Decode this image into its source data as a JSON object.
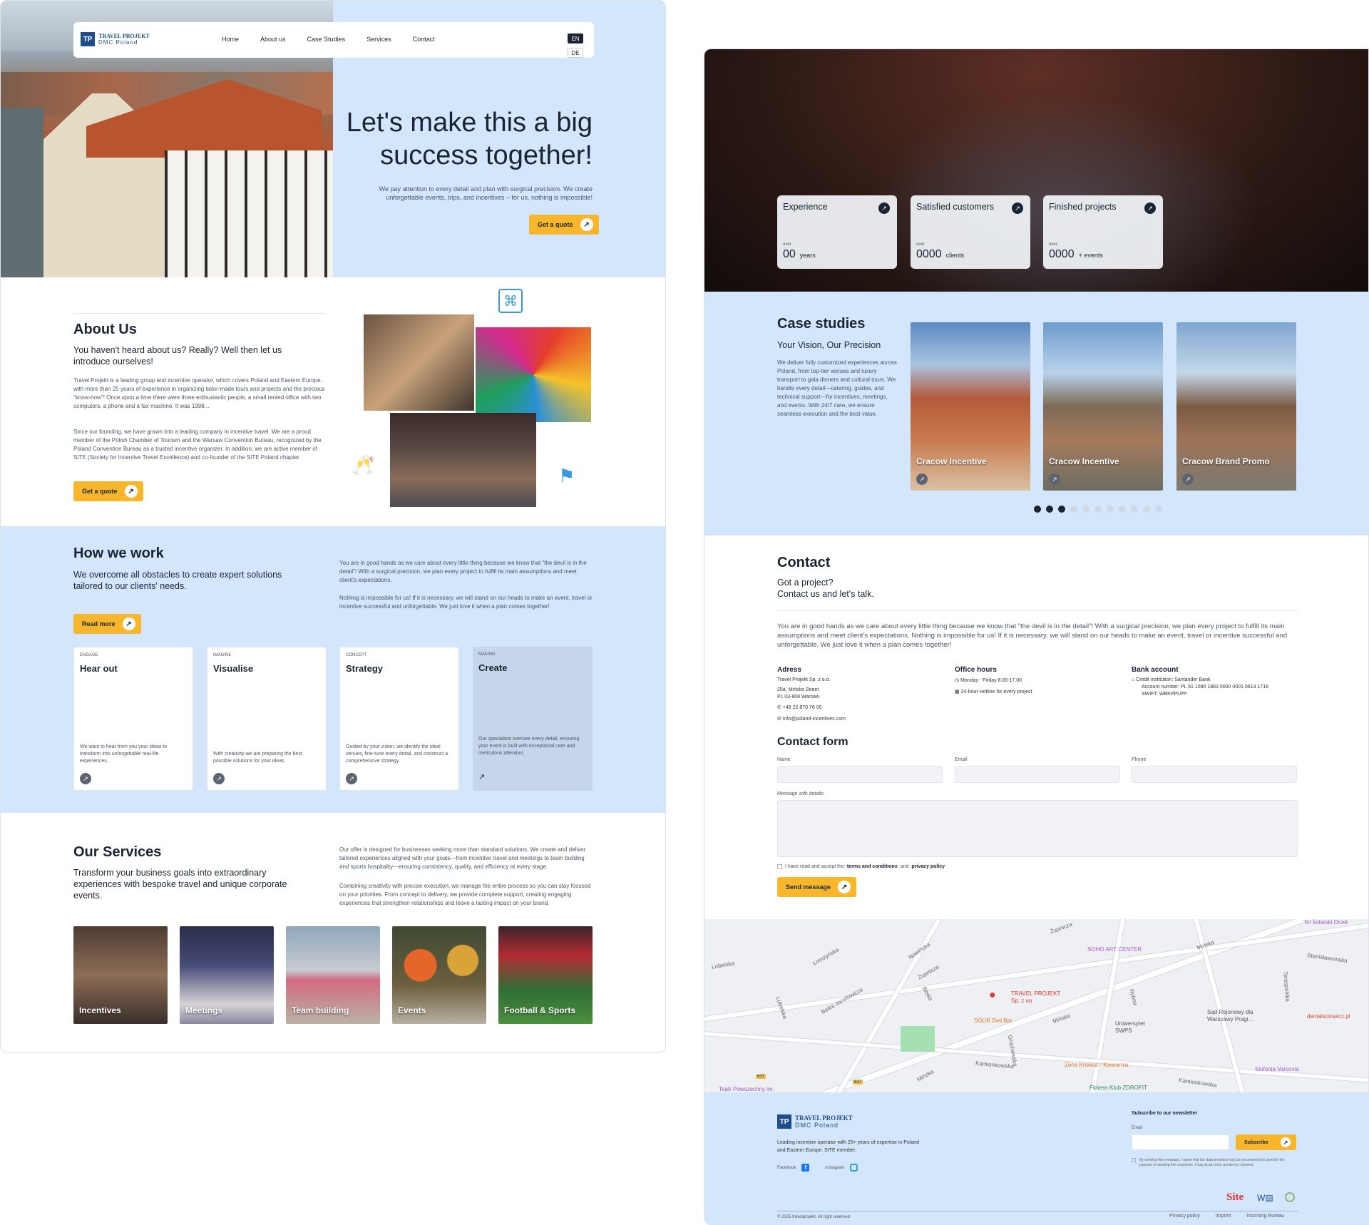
{
  "left": {
    "header": {
      "logo_line1": "TRAVEL PROJEKT",
      "logo_line2": "DMC  Poland",
      "nav": [
        "Home",
        "About us",
        "Case Studies",
        "Services",
        "Contact"
      ],
      "lang_active": "EN",
      "lang_other": "DE"
    },
    "hero": {
      "title_line1": "Let's make this a big",
      "title_line2": "success together!",
      "text": "We pay attention to every detail and plan with surgical precision. We create unforgettable events, trips, and incentives – for us, nothing is impossible!",
      "cta": "Get a quote"
    },
    "about": {
      "title": "About Us",
      "subtitle": "You haven't heard about us? Really? Well then let us introduce ourselves!",
      "p1": "Travel Projekt is a leading group and incentive operator, which covers Poland and Eastern Europe, with more than 25 years of experience in organizing tailor-made tours and projects and the precious \"know-how\"! Once upon a time there were three enthusiastic people, a small rented office with two computers, a phone and a fax machine. It was 1998...",
      "p2": "Since our founding, we have grown into a leading company in incentive travel. We are a proud member of the Polish Chamber of Tourism and the Warsaw Convention Bureau, recognized by the Poland Convention Bureau as a trusted incentive organizer. In addition, we are active member of SITE (Society for Incentive Travel Excellence) and co-founder of the SITE Poland chapter.",
      "cta": "Get a quote"
    },
    "how": {
      "title": "How we work",
      "subtitle": "We overcome all obstacles to create expert solutions tailored to our clients' needs.",
      "p1": "You are in good hands as we care about every little thing because we know that \"the devil is in the detail\"! With a surgical precision, we plan every project to fulfill its main assumptions and meet client's expectations.",
      "p2": "Nothing is impossible for us! If it is necessary, we will stand on our heads to make an event, travel or incentive successful and unforgettable. We just love it when a plan comes together!",
      "cta": "Read more",
      "steps": [
        {
          "tag": "ENGAGE",
          "title": "Hear out",
          "text": "We want to hear from you your ideas to transform into unforgettable real-life experiences."
        },
        {
          "tag": "IMAGINE",
          "title": "Visualise",
          "text": "With creativity we are preparing the best possible solutions for your ideas"
        },
        {
          "tag": "CONCEPT",
          "title": "Strategy",
          "text": "Guided by your vision, we identify the ideal venues, fine-tune every detail, and construct a comprehensive strategy."
        },
        {
          "tag": "MAKING",
          "title": "Create",
          "text": "Our specialists oversee every detail, ensuring your event is built with exceptional care and meticulous attention."
        }
      ]
    },
    "services": {
      "title": "Our Services",
      "subtitle": "Transform your business goals into extraordinary experiences with bespoke travel and unique corporate events.",
      "p1": "Our offer is designed for businesses seeking more than standard solutions. We create and deliver tailored experiences aligned with your goals—from incentive travel and meetings to team building and sports hospitality—ensuring consistency, quality, and efficiency at every stage.",
      "p2": "Combining creativity with precise execution, we manage the entire process so you can stay focused on your priorities. From concept to delivery, we provide complete support, creating engaging experiences that strengthen relationships and leave a lasting impact on your brand.",
      "items": [
        "Incentives",
        "Meetings",
        "Team building",
        "Events",
        "Football & Sports"
      ]
    }
  },
  "right": {
    "stats": [
      {
        "label": "Experience",
        "over": "over",
        "value": "00",
        "unit": "years"
      },
      {
        "label": "Satisfied customers",
        "over": "over",
        "value": "0000",
        "unit": "clients"
      },
      {
        "label": "Finished projects",
        "over": "over",
        "value": "0000",
        "unit": "+   events"
      }
    ],
    "cases": {
      "title": "Case studies",
      "subtitle": "Your Vision, Our Precision",
      "text": "We deliver fully customized experiences across Poland, from top-tier venues and luxury transport to gala dinners and cultural tours. We handle every detail—catering, guides, and technical support—for incentives, meetings, and events. With 24/7 care, we ensure seamless execution and the best value.",
      "items": [
        "Cracow Incentive",
        "Cracow Incentive",
        "Cracow Brand Promo"
      ],
      "dots_active": 3,
      "dots_total": 11
    },
    "contact": {
      "title": "Contact",
      "subtitle_line1": "Got a project?",
      "subtitle_line2": "Contact us and let's talk.",
      "text": "You are in good hands as we care about every little thing because we know that \"the devil is in the detail\"! With a surgical precision, we plan every project to fulfill its main assumptions and meet client's expectations. Nothing is impossible for us! If it is necessary, we will stand on our heads to make an event, travel or incentive successful and unforgettable. We just love it when a plan comes together!",
      "address_title": "Adress",
      "address_lines": [
        "Travel Projekt Sp. z o.o.",
        "25a, Mińska Street",
        "PL 03-808 Warsaw"
      ],
      "phone": "+48 22 870 76 00",
      "email": "info@poland-incentives.com",
      "hours_title": "Office hours",
      "hours_1": "Monday - Friday 8.00-17.00",
      "hours_2": "24-hour Hotline for every project",
      "bank_title": "Bank account",
      "bank_1": "Credit institution: Santander Bank",
      "bank_2": "Account number: PL 51 1090 1883 0000 0001 0613 1716",
      "bank_3": "SWIFT: WBKPPLPP",
      "form_title": "Contact form",
      "name_label": "Name",
      "email_label": "Email",
      "phone_label": "Phone",
      "message_label": "Message with details",
      "consent_pre": "I have read and accept the ",
      "consent_terms": "terms and conditions",
      "consent_and": " and ",
      "consent_privacy": "privacy policy",
      "submit": "Send message"
    },
    "map": {
      "streets": [
        "Żupnicza",
        "Mińska",
        "Stanisławowska",
        "Lubelska",
        "Łomżyńska",
        "Nowińska",
        "Żupnicza",
        "Bliska",
        "Beika Józefowicza",
        "Lubelska",
        "Mińska",
        "Grochowska",
        "Kamionkowska",
        "Terespolska",
        "Rybna",
        "Mińska",
        "Kamionkowska"
      ],
      "pois": [
        "SOHO ART CENTER",
        "TRAVEL PROJEKT Sp. z oo",
        "SOUR Deli Bar",
        "Uniwersytet SWPS",
        "Sąd Rejonowy dla Warszawy Pragi...",
        "dentalsolowicz.pl",
        "Zona Krawca - Kawiarnia",
        "Sinfonia Varsovia",
        "Fitness Klub ZDROFIT",
        "Teatr Powszechny im.",
        "Tor kolarski Orzeł"
      ],
      "routes": [
        "637",
        "637"
      ]
    },
    "footer": {
      "logo_line1": "TRAVEL PROJEKT",
      "logo_line2": "DMC  Poland",
      "desc": "Leading incentive operator with 25+ years of expertise in Poland and Eastern Europe. SITE member.",
      "facebook": "Facebook",
      "instagram": "Instagram",
      "newsletter_title": "Subscribe to our newsletter",
      "email_label": "Email",
      "subscribe": "Subscribe",
      "newsletter_note": "By sending this message, I agree that the data provided may be processed and used for the purpose of sending the newsletter. I may at any time revoke my consent.",
      "badge_site": "Site",
      "copyright": "© 2025 travelprojekt. All right reserved",
      "links": [
        "Privacy policy",
        "Imprint",
        "Incoming Bureau"
      ]
    }
  },
  "colors": {
    "accent": "#f7b62b",
    "light_blue": "#d4e6fb",
    "dark_text": "#1b2433",
    "step_active": "#c5d6ea"
  }
}
